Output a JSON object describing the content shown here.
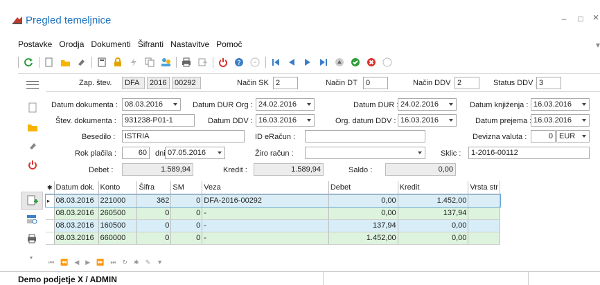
{
  "window": {
    "title": "Pregled temeljnice",
    "minimize": "–",
    "maximize": "□",
    "close": "×"
  },
  "menu": [
    "Postavke",
    "Orodja",
    "Dokumenti",
    "Šifranti",
    "Nastavitve",
    "Pomoč"
  ],
  "header": {
    "zap_stev_label": "Zap. štev.",
    "zap_stev_1": "DFA",
    "zap_stev_2": "2016",
    "zap_stev_3": "00292",
    "nacin_sk_label": "Način SK",
    "nacin_sk": "2",
    "nacin_dt_label": "Način DT",
    "nacin_dt": "0",
    "nacin_ddv_label": "Način DDV",
    "nacin_ddv": "2",
    "status_ddv_label": "Status DDV",
    "status_ddv": "3"
  },
  "form": {
    "datum_dokumenta_label": "Datum dokumenta :",
    "datum_dokumenta": "08.03.2016",
    "datum_dur_org_label": "Datum DUR Org :",
    "datum_dur_org": "24.02.2016",
    "datum_dur_label": "Datum DUR :",
    "datum_dur": "24.02.2016",
    "datum_knjizenja_label": "Datum knjiženja :",
    "datum_knjizenja": "16.03.2016",
    "stev_dokumenta_label": "Štev. dokumenta :",
    "stev_dokumenta": "931238-P01-1",
    "datum_ddv_label": "Datum DDV :",
    "datum_ddv": "16.03.2016",
    "org_datum_ddv_label": "Org. datum DDV :",
    "org_datum_ddv": "16.03.2016",
    "datum_prejema_label": "Datum prejema :",
    "datum_prejema": "16.03.2016",
    "besedilo_label": "Besedilo :",
    "besedilo": "ISTRIA",
    "id_eracun_label": "ID eRačun :",
    "id_eracun": "",
    "devizna_valuta_label": "Devizna valuta :",
    "devizna_valuta_num": "0",
    "devizna_valuta": "EUR",
    "rok_placila_label": "Rok plačila :",
    "rok_placila": "60",
    "dni_label": "dni",
    "rok_datum": "07.05.2016",
    "ziro_racun_label": "Žiro račun :",
    "ziro_racun": "",
    "sklic_label": "Sklic :",
    "sklic": "1-2016-00112",
    "debet_label": "Debet :",
    "debet": "1.589,94",
    "kredit_label": "Kredit :",
    "kredit": "1.589,94",
    "saldo_label": "Saldo :",
    "saldo": "0,00"
  },
  "table": {
    "headers": [
      "Datum dok.",
      "Konto",
      "Šifra",
      "SM",
      "Veza",
      "Debet",
      "Kredit",
      "Vrsta str"
    ],
    "rows": [
      [
        "08.03.2016",
        "221000",
        "362",
        "0",
        "DFA-2016-00292",
        "0,00",
        "1.452,00",
        ""
      ],
      [
        "08.03.2016",
        "260500",
        "0",
        "0",
        "-",
        "0,00",
        "137,94",
        ""
      ],
      [
        "08.03.2016",
        "160500",
        "0",
        "0",
        "-",
        "137,94",
        "0,00",
        ""
      ],
      [
        "08.03.2016",
        "660000",
        "0",
        "0",
        "-",
        "1.452,00",
        "0,00",
        ""
      ]
    ]
  },
  "status": {
    "text": "Demo podjetje X / ADMIN"
  },
  "colors": {
    "accent": "#1e73be",
    "row_selected": "#dbeef7",
    "row_green": "#ddf3dd",
    "row_blue": "#d7edf7"
  }
}
